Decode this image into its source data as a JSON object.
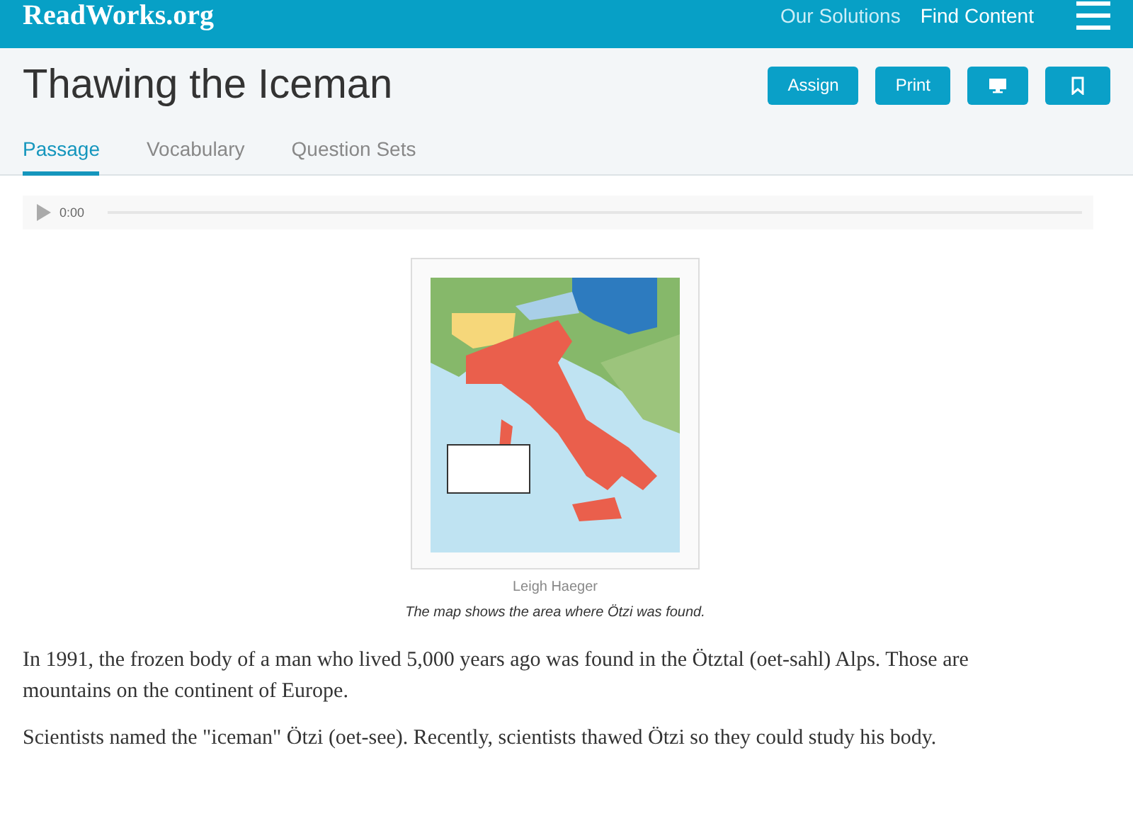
{
  "header": {
    "logo": "ReadWorks.org",
    "nav": [
      "Our Solutions",
      "Find Content"
    ]
  },
  "title": "Thawing the Iceman",
  "actions": [
    {
      "kind": "text",
      "label": "Assign"
    },
    {
      "kind": "text",
      "label": "Print"
    },
    {
      "kind": "monitor"
    },
    {
      "kind": "bookmark"
    }
  ],
  "tabs": [
    {
      "label": "Passage",
      "selected": true
    },
    {
      "label": "Vocabulary",
      "selected": false
    },
    {
      "label": "Question Sets",
      "selected": false
    }
  ],
  "audio": {
    "time": "0:00"
  },
  "figure": {
    "kind": "picture",
    "credit": "Leigh Haeger",
    "caption": "The map shows the area where Ötzi was found."
  },
  "paragraphs": [
    "In 1991, the frozen body of a man who lived 5,000 years ago was found in the Ötztal (oet-sahl) Alps. Those are mountains on the continent of Europe.",
    "Scientists named the \"iceman\" Ötzi (oet-see). Recently, scientists thawed Ötzi so they could study his body."
  ]
}
